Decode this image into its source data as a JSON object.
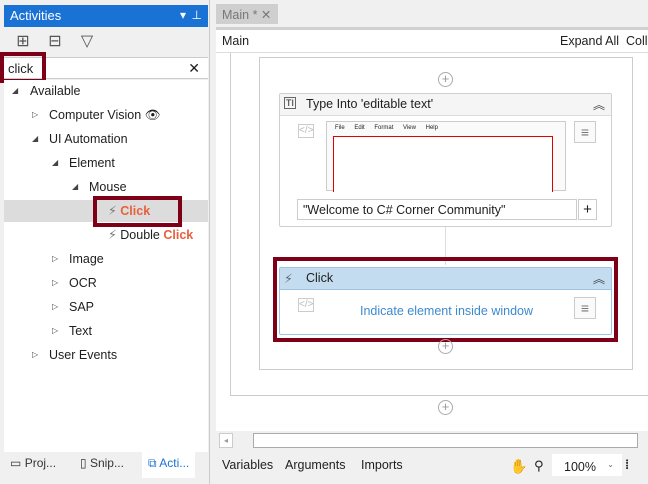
{
  "activities_panel": {
    "title": "Activities",
    "search_value": "click",
    "tree": [
      {
        "label": "Available",
        "level": 0
      },
      {
        "label": "Computer Vision",
        "level": 1
      },
      {
        "label": "UI Automation",
        "level": 1
      },
      {
        "label": "Element",
        "level": 2
      },
      {
        "label": "Mouse",
        "level": 3
      },
      {
        "label": "Click",
        "level": 4,
        "selected": true
      },
      {
        "label_prefix": "Double ",
        "label_match": "Click",
        "level": 4
      },
      {
        "label": "Image",
        "level": 2
      },
      {
        "label": "OCR",
        "level": 2
      },
      {
        "label": "SAP",
        "level": 2
      },
      {
        "label": "Text",
        "level": 2
      },
      {
        "label": "User Events",
        "level": 1
      }
    ],
    "bottom_tabs": [
      "Proj...",
      "Snip...",
      "Acti..."
    ]
  },
  "doc_tab": {
    "label": "Main *"
  },
  "header": {
    "breadcrumb": "Main",
    "expand_all": "Expand All",
    "collapse_all": "Colla"
  },
  "designer": {
    "type_into": {
      "title": "Type Into 'editable text'",
      "text_value": "\"Welcome to C# Corner Community\"",
      "preview_menu": [
        "File",
        "Edit",
        "Format",
        "View",
        "Help"
      ]
    },
    "click": {
      "title": "Click",
      "indicate": "Indicate element inside window"
    }
  },
  "statusbar": {
    "variables": "Variables",
    "arguments": "Arguments",
    "imports": "Imports",
    "zoom": "100%"
  },
  "colors": {
    "accent": "#1a72d4",
    "highlight": "#7e0018",
    "match": "#e8603c"
  }
}
